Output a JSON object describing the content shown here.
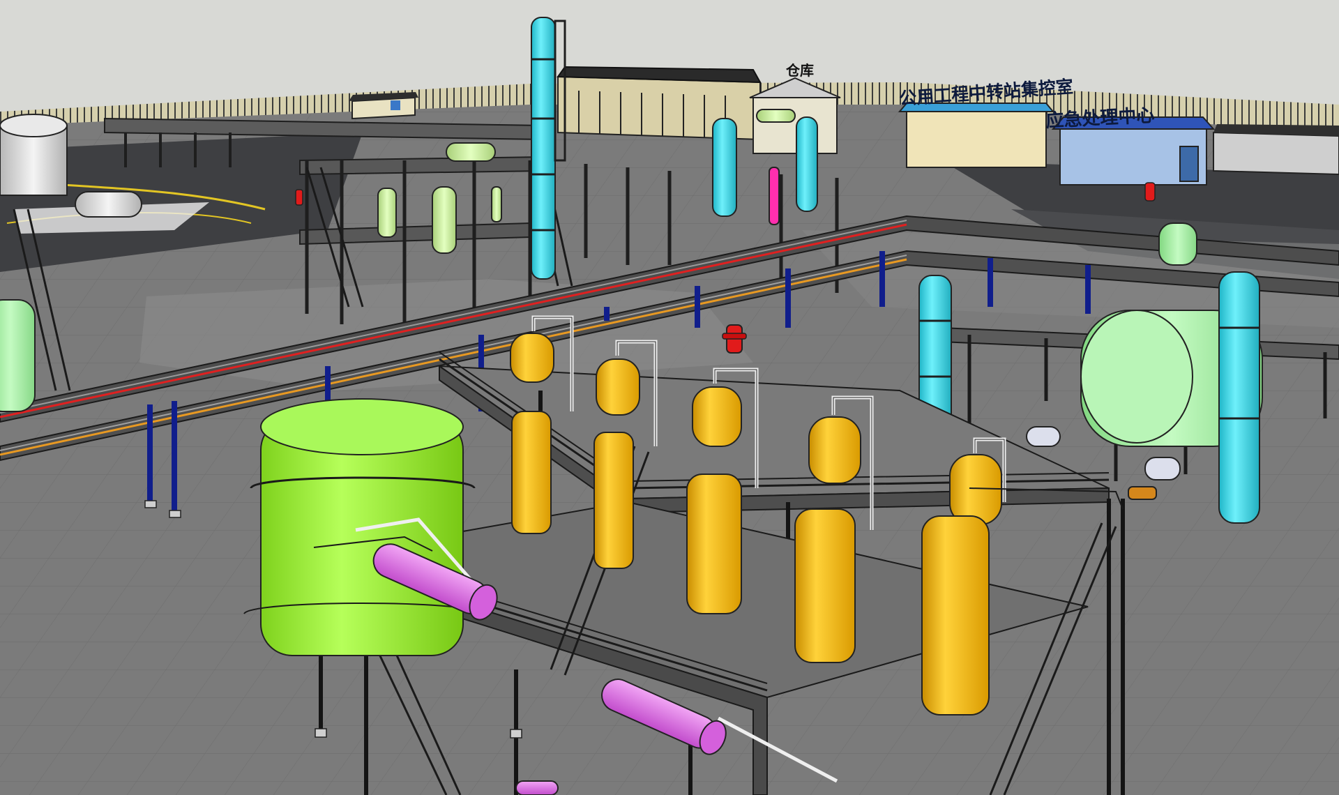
{
  "scene": {
    "signs": {
      "warehouse": "仓库",
      "station": "公用工程中转站集控室",
      "emergency": "应急处理中心"
    }
  },
  "colors": {
    "sky": "#d8d9d5",
    "ground": "#7b7b7b",
    "road": "#3e3f42",
    "platform": "#686868",
    "steel": "#1e1e1e",
    "yellow_vessel": "#f2b306",
    "green_tank": "#9aee3a",
    "magenta_exchanger": "#e07be8",
    "cyan_column": "#3bd7e6",
    "pale_green": "#c5ea9a",
    "mint_tank": "#a9eea8",
    "blue_support": "#101e8c",
    "hydrant_red": "#e11b1b",
    "building_cream": "#f0e4b8",
    "building_blue": "#a7c2e6"
  },
  "icons": {
    "hydrant": "fire-hydrant-icon",
    "vessel": "pressure-vessel-icon"
  }
}
